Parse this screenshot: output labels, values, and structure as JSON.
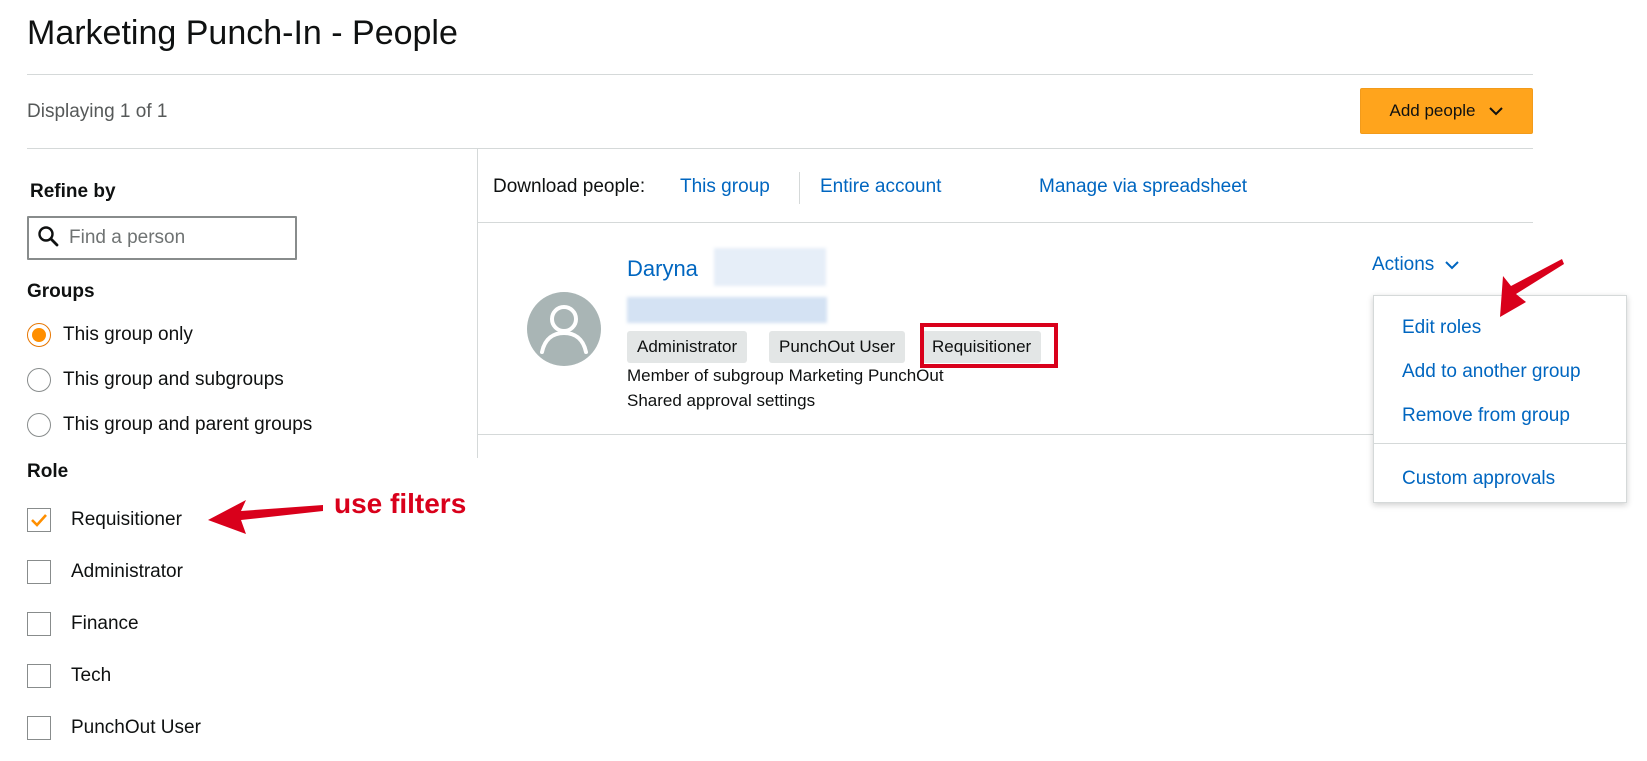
{
  "page": {
    "title": "Marketing Punch-In - People",
    "displaying": "Displaying 1 of 1",
    "add_people_label": "Add people"
  },
  "refine": {
    "title": "Refine by",
    "search_placeholder": "Find a person",
    "groups_label": "Groups",
    "groups": [
      {
        "label": "This group only",
        "checked": true
      },
      {
        "label": "This group and subgroups",
        "checked": false
      },
      {
        "label": "This group and parent groups",
        "checked": false
      }
    ],
    "role_label": "Role",
    "roles": [
      {
        "label": "Requisitioner",
        "checked": true
      },
      {
        "label": "Administrator",
        "checked": false
      },
      {
        "label": "Finance",
        "checked": false
      },
      {
        "label": "Tech",
        "checked": false
      },
      {
        "label": "PunchOut User",
        "checked": false
      }
    ]
  },
  "download": {
    "label": "Download people:",
    "this_group": "This group",
    "entire_account": "Entire account",
    "manage_spreadsheet": "Manage via spreadsheet"
  },
  "person": {
    "name": "Daryna",
    "roles": [
      "Administrator",
      "PunchOut User",
      "Requisitioner"
    ],
    "subgroup_text": "Member of subgroup Marketing PunchOut",
    "approval_text": "Shared approval settings"
  },
  "actions": {
    "label": "Actions",
    "items": [
      "Edit roles",
      "Add to another group",
      "Remove from group",
      "Custom approvals"
    ]
  },
  "annotations": {
    "filters_note": "use filters"
  },
  "colors": {
    "accent_orange": "#ffa41c",
    "link_blue": "#0066c0",
    "annotation_red": "#d9001b"
  }
}
